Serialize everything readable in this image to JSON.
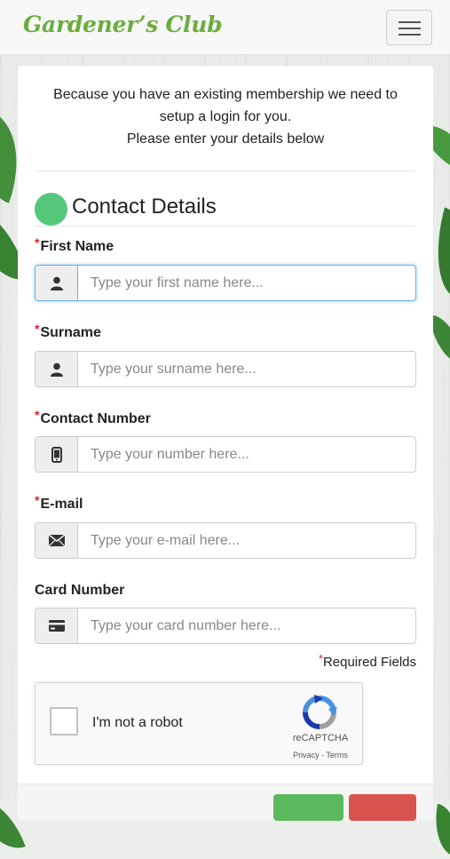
{
  "brand": "Gardener’s Club",
  "intro": {
    "line1": "Because you have an existing membership we need to",
    "line2": "setup a login for you.",
    "line3": "Please enter your details below"
  },
  "section_title": "Contact Details",
  "required_marker": "*",
  "fields": [
    {
      "label": "First Name",
      "placeholder": "Type your first name here...",
      "required": true,
      "icon": "user-icon"
    },
    {
      "label": "Surname",
      "placeholder": "Type your surname here...",
      "required": true,
      "icon": "user-icon"
    },
    {
      "label": "Contact Number",
      "placeholder": "Type your number here...",
      "required": true,
      "icon": "mobile-phone-icon"
    },
    {
      "label": "E-mail",
      "placeholder": "Type your e-mail here...",
      "required": true,
      "icon": "envelope-icon"
    },
    {
      "label": "Card Number",
      "placeholder": "Type your card number here...",
      "required": false,
      "icon": "credit-card-icon"
    }
  ],
  "required_note": "Required Fields",
  "captcha": {
    "label": "I'm not a robot",
    "brand": "reCAPTCHA",
    "privacy": "Privacy",
    "separator": " - ",
    "terms": "Terms"
  },
  "colors": {
    "brand": "#6aad3c",
    "section_dot": "#55c77a",
    "required": "#e0202a",
    "focus": "#66afe9",
    "submit": "#5cb85c",
    "cancel": "#d9534f"
  }
}
